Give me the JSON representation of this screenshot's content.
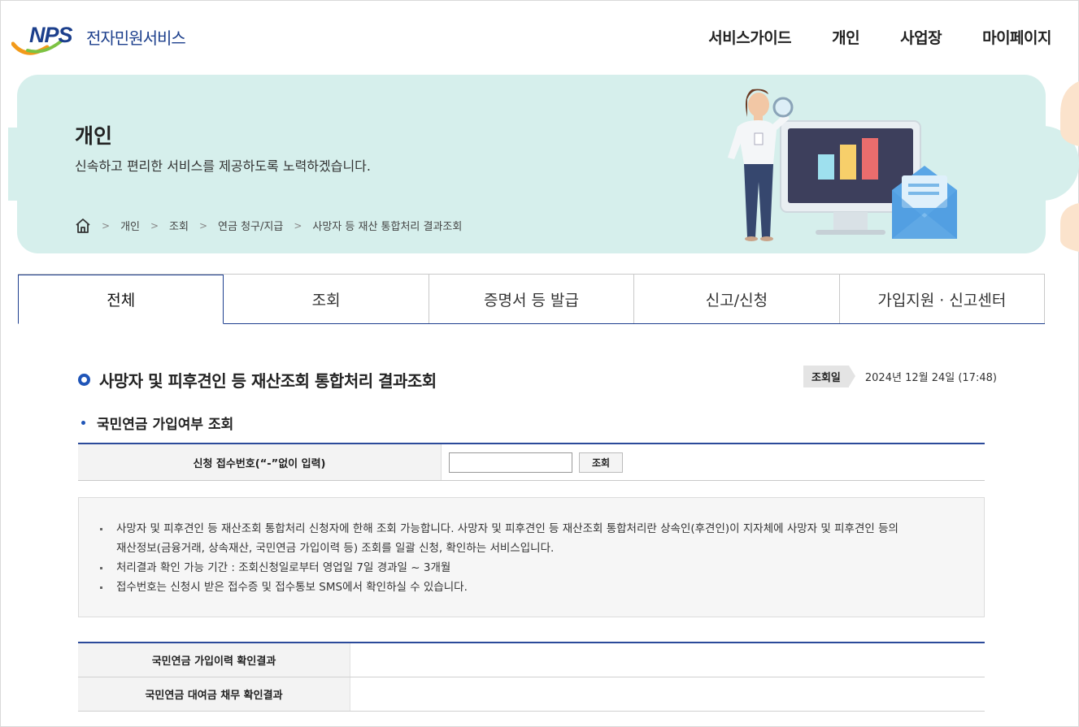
{
  "header": {
    "logo_mark": "NPS",
    "logo_text": "전자민원서비스",
    "nav": [
      "서비스가이드",
      "개인",
      "사업장",
      "마이페이지"
    ]
  },
  "banner": {
    "title": "개인",
    "subtitle": "신속하고 편리한 서비스를 제공하도록 노력하겠습니다.",
    "breadcrumb": [
      "개인",
      "조회",
      "연금 청구/지급",
      "사망자 등 재산 통합처리 결과조회"
    ]
  },
  "tabs": [
    {
      "label": "전체",
      "active": true
    },
    {
      "label": "조회",
      "active": false
    },
    {
      "label": "증명서 등 발급",
      "active": false
    },
    {
      "label": "신고/신청",
      "active": false
    },
    {
      "label": "가입지원 · 신고센터",
      "active": false
    }
  ],
  "page": {
    "title": "사망자 및 피후견인 등 재산조회 통합처리 결과조회",
    "date_label": "조회일",
    "date_value": "2024년 12월 24일 (17:48)",
    "section_title": "국민연금 가입여부 조회"
  },
  "form": {
    "field_label": "신청 접수번호(“-”없이 입력)",
    "field_value": "",
    "button_label": "조회"
  },
  "notice": {
    "items": [
      "사망자 및 피후견인 등 재산조회 통합처리 신청자에 한해 조회 가능합니다. 사망자 및 피후견인 등 재산조회 통합처리란 상속인(후견인)이 지자체에 사망자 및 피후견인 등의",
      "재산정보(금융거래, 상속재산, 국민연금 가입이력 등) 조회를 일괄 신청, 확인하는 서비스입니다.",
      "처리결과 확인 가능 기간 : 조회신청일로부터 영업일 7일 경과일 ~    3개월",
      "접수번호는 신청시 받은 접수증 및 접수통보 SMS에서 확인하실 수 있습니다."
    ]
  },
  "results": {
    "rows": [
      {
        "label": "국민연금 가입이력 확인결과",
        "value": ""
      },
      {
        "label": "국민연금 대여금 채무 확인결과",
        "value": ""
      }
    ]
  },
  "colors": {
    "brand_navy": "#1c3f8c",
    "banner_bg": "#d6efec",
    "accent_blue": "#1f55b8"
  }
}
